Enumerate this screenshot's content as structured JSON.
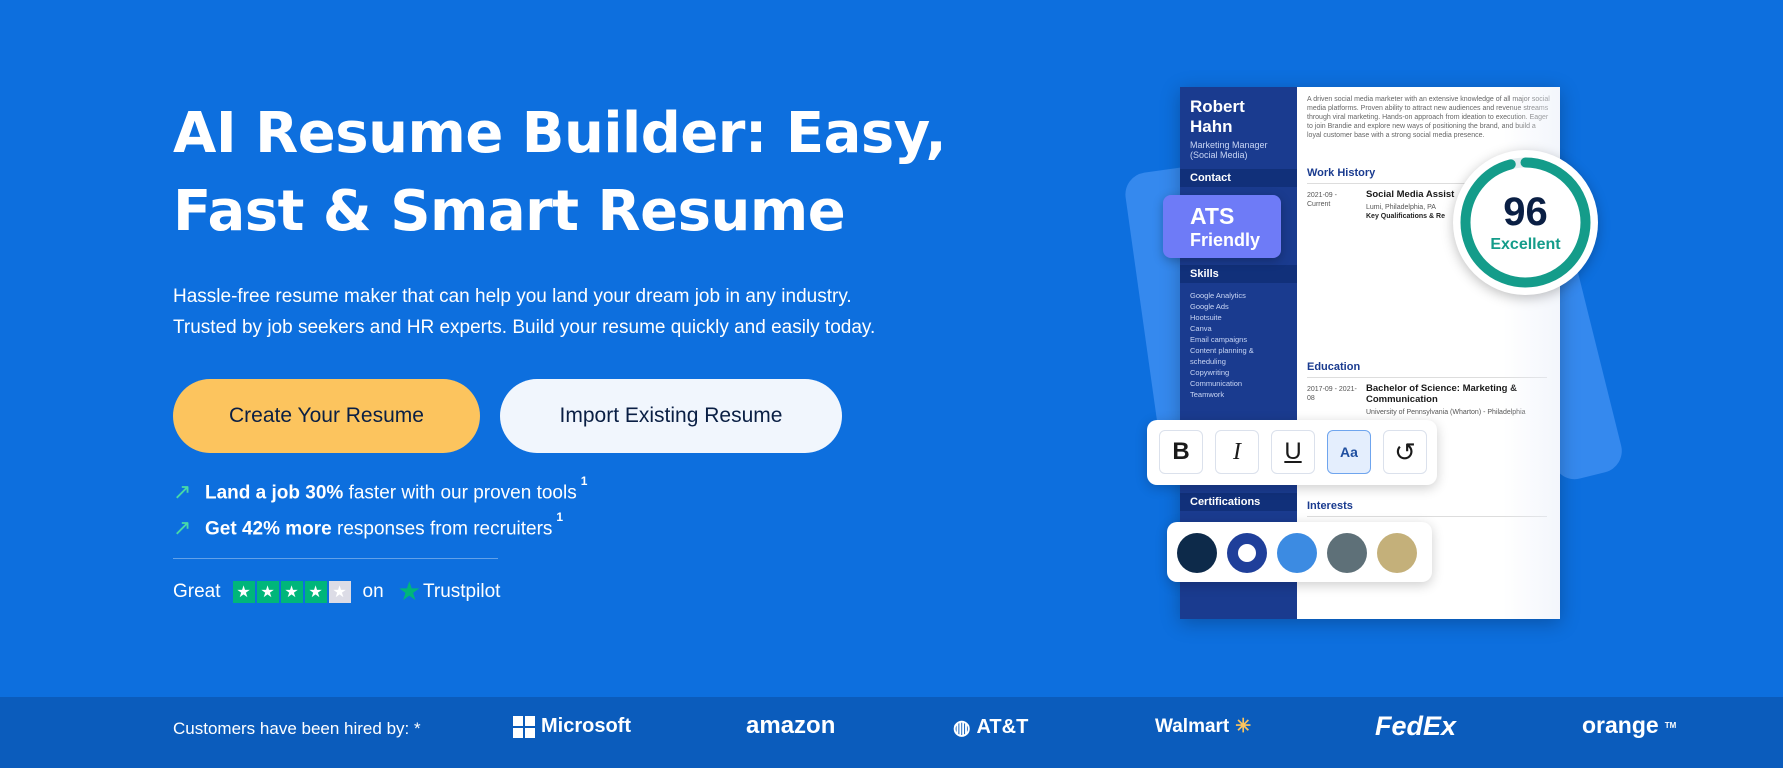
{
  "hero": {
    "title": "AI Resume Builder: Easy, Fast & Smart Resume",
    "subtitle_line1": "Hassle-free resume maker that can help you land your dream job in any industry.",
    "subtitle_line2": "Trusted by job seekers and HR experts. Build your resume quickly and easily today.",
    "primary_button": "Create Your Resume",
    "secondary_button": "Import Existing Resume",
    "bullets": [
      {
        "bold": "Land a job 30%",
        "rest": " faster with our proven tools",
        "sup": "1"
      },
      {
        "bold": "Get 42% more",
        "rest": " responses from recruiters",
        "sup": "1"
      }
    ],
    "trustpilot": {
      "rating_word": "Great",
      "stars": 4,
      "on": "on",
      "brand": "Trustpilot"
    }
  },
  "resume_preview": {
    "name_first": "Robert",
    "name_last": "Hahn",
    "role": "Marketing Manager (Social Media)",
    "intro": "A driven social media marketer with an extensive knowledge of all major social media platforms. Proven ability to attract new audiences and revenue streams through viral marketing. Hands-on approach from ideation to execution. Eager to join Brandie and explore new ways of positioning the brand, and build a loyal customer base with a strong social media presence.",
    "sections": {
      "contact": "Contact",
      "skills": "Skills",
      "certifications": "Certifications",
      "work": "Work History",
      "education": "Education",
      "interests": "Interests"
    },
    "skills": [
      "Google Analytics",
      "Google Ads",
      "Hootsuite",
      "Canva",
      "Email campaigns",
      "Content planning &",
      "scheduling",
      "Copywriting",
      "Communication",
      "Teamwork"
    ],
    "job_date": "2021-09 - Current",
    "job_title": "Social Media Assist",
    "job_company": "Lumi, Philadelphia, PA",
    "job_key": "Key Qualifications & Re",
    "edu_date": "2017-09 - 2021-08",
    "edu_degree": "Bachelor of Science: Marketing & Communication",
    "edu_school": "University of Pennsylvania (Wharton) - Philadelphia"
  },
  "ats_badge": {
    "line1": "ATS",
    "line2": "Friendly"
  },
  "score": {
    "value": "96",
    "label": "Excellent",
    "fraction": 0.96,
    "color": "#149c8a"
  },
  "toolbar": {
    "bold": "B",
    "italic": "I",
    "underline": "U",
    "spellcheck": "Aa",
    "undo": "↺"
  },
  "swatches": [
    "#0d2a4a",
    "#1f3f9a",
    "#3c8be2",
    "#5e7078",
    "#c4b07a"
  ],
  "footer": {
    "caption": "Customers have been hired by: *",
    "logos": [
      "Microsoft",
      "amazon",
      "AT&T",
      "Walmart",
      "FedEx",
      "orange"
    ]
  }
}
